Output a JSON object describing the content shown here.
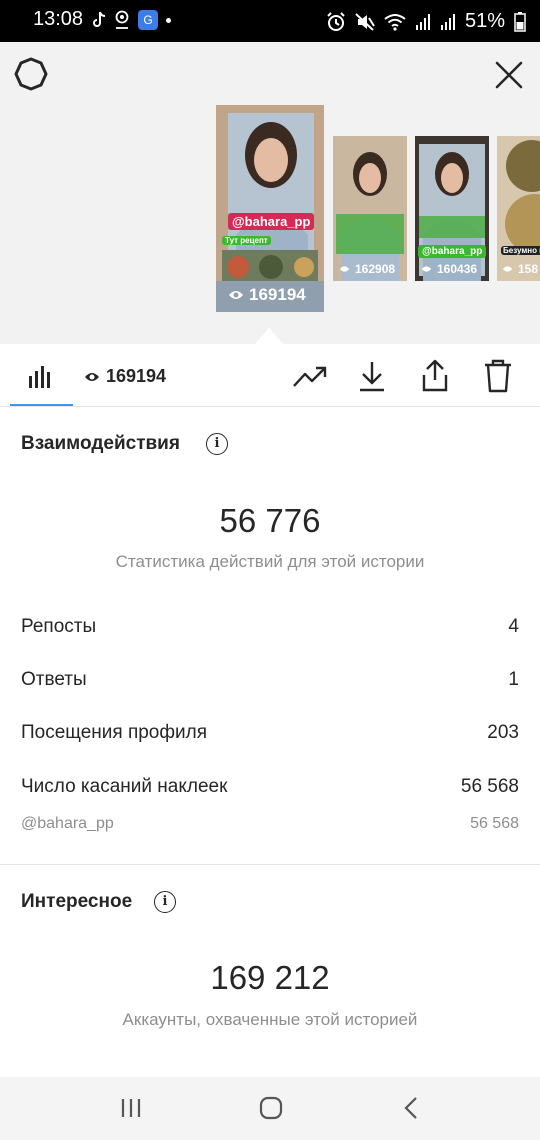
{
  "status_bar": {
    "time": "13:08",
    "battery_pct": "51%",
    "app_badge": "G",
    "left_icons": [
      "tiktok-icon",
      "location-icon",
      "app-badge-icon",
      "dot"
    ],
    "right_icons": [
      "alarm-icon",
      "mute-icon",
      "wifi-icon",
      "signal-icon",
      "signal-icon",
      "battery-icon"
    ]
  },
  "stories": {
    "selected": {
      "views": "169194",
      "tag": "@bahara_pp",
      "caption": "Тут рецепт"
    },
    "others": [
      {
        "views": "162908"
      },
      {
        "views": "160436",
        "tag": "@bahara_pp"
      },
      {
        "views": "158",
        "caption": "Безумно кр"
      }
    ]
  },
  "tabbar": {
    "views": "169194",
    "actions": [
      "trend-icon",
      "download-icon",
      "share-icon",
      "trash-icon"
    ]
  },
  "interactions": {
    "title": "Взаимодействия",
    "total": "56 776",
    "subtitle": "Статистика действий для этой истории",
    "rows": [
      {
        "label": "Репосты",
        "value": "4"
      },
      {
        "label": "Ответы",
        "value": "1"
      },
      {
        "label": "Посещения профиля",
        "value": "203"
      },
      {
        "label": "Число касаний наклеек",
        "value": "56 568"
      }
    ],
    "sub_row": {
      "label": "@bahara_pp",
      "value": "56 568"
    }
  },
  "discovery": {
    "title": "Интересное",
    "total": "169 212",
    "subtitle": "Аккаунты, охваченные этой историей"
  },
  "colors": {
    "accent": "#3897f0",
    "text": "#262626",
    "muted": "#8e8e8e",
    "tag_pink": "#d42a55",
    "tag_green": "#3cb82e"
  }
}
